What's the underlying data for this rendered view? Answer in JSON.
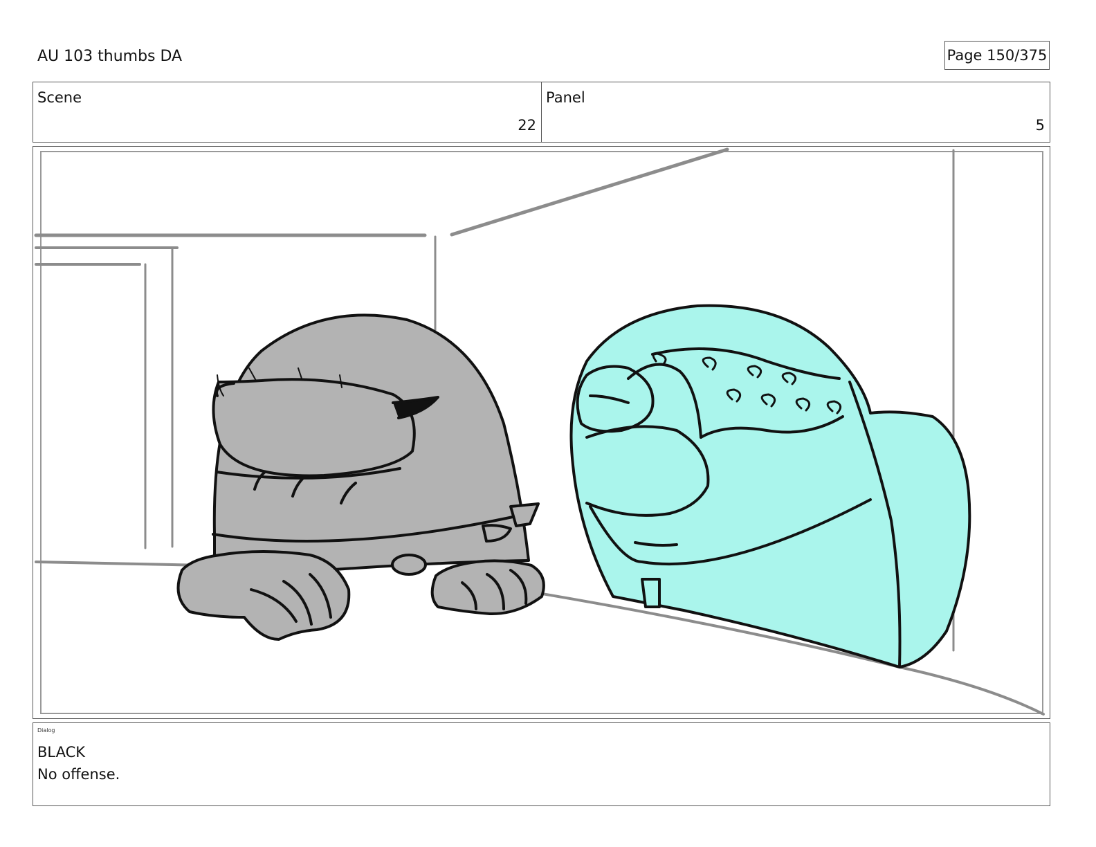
{
  "header": {
    "doc_title": "AU 103 thumbs DA",
    "page_label": "Page 150/375"
  },
  "info": {
    "scene_label": "Scene",
    "scene_value": "22",
    "panel_label": "Panel",
    "panel_value": "5"
  },
  "colors": {
    "grey_character": "#b3b3b3",
    "cyan_character": "#aaf5ec",
    "background_lines": "#8c8c8c",
    "ink": "#111111"
  },
  "dialog": {
    "label": "Dialog",
    "lines": [
      "BLACK",
      "No offense."
    ]
  }
}
